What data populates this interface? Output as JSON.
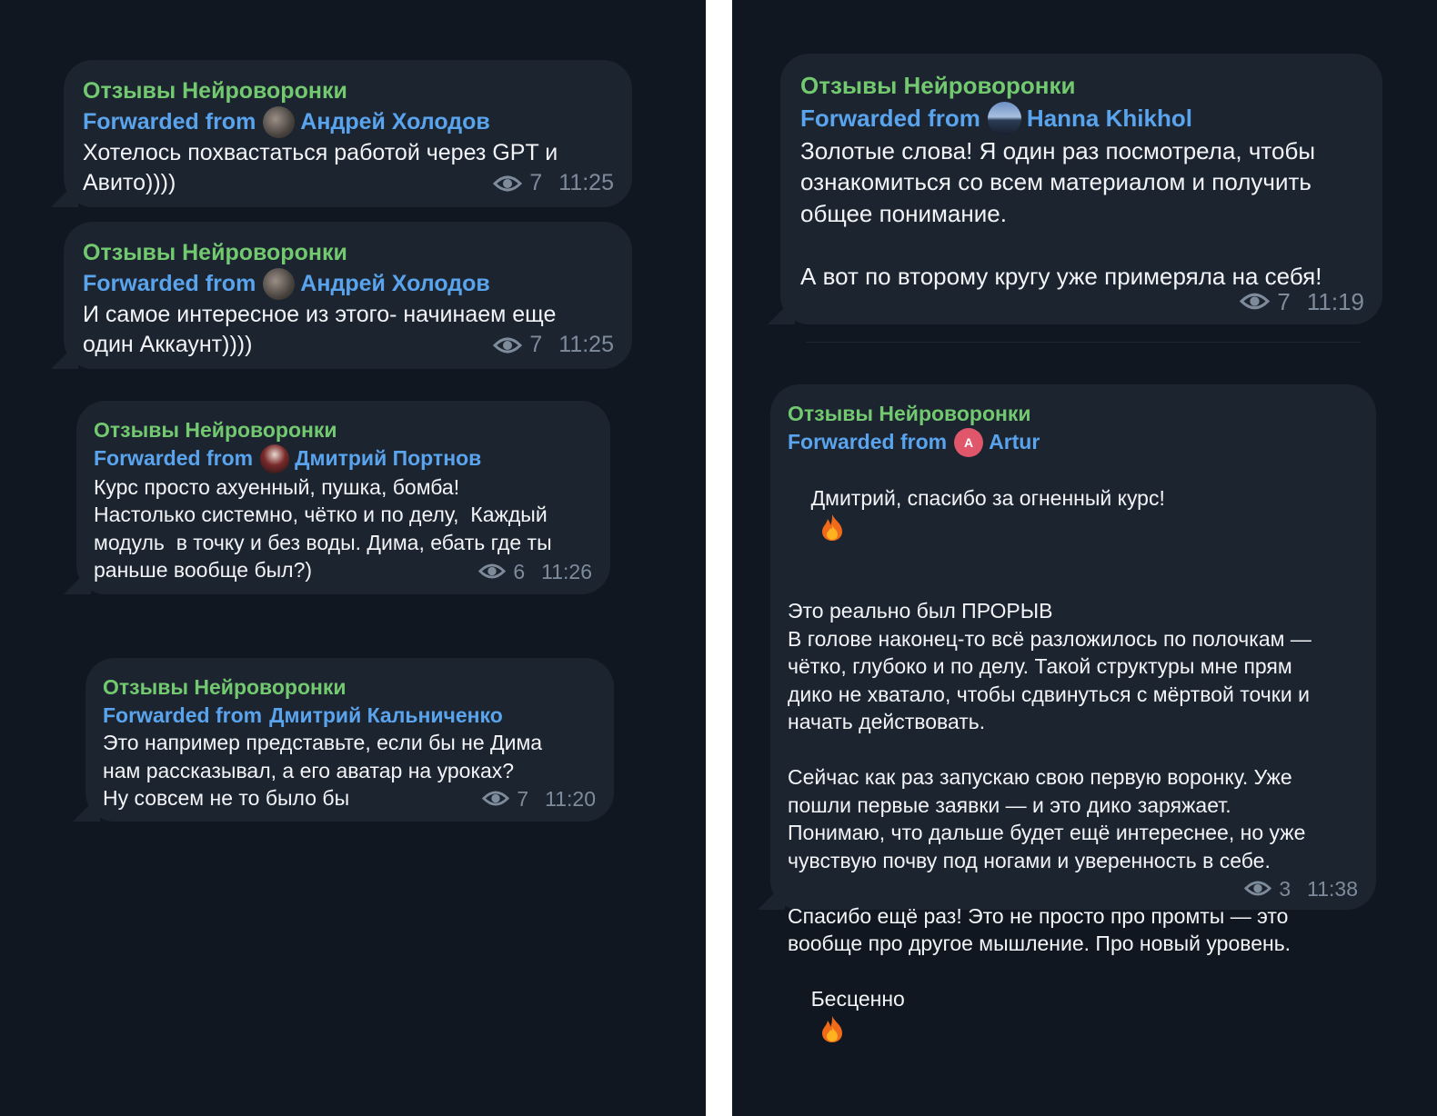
{
  "messages": [
    {
      "channel": "Отзывы Нейроворонки",
      "forward_prefix": "Forwarded from",
      "author": "Андрей Холодов",
      "text": "Хотелось похвастаться работой через GPT и\nАвито))))",
      "views": "7",
      "time": "11:25"
    },
    {
      "channel": "Отзывы Нейроворонки",
      "forward_prefix": "Forwarded from",
      "author": "Андрей Холодов",
      "text": "И самое интересное из этого- начинаем еще\nодин Аккаунт))))",
      "views": "7",
      "time": "11:25"
    },
    {
      "channel": "Отзывы Нейроворонки",
      "forward_prefix": "Forwarded from",
      "author": "Дмитрий Портнов",
      "text": "Курс просто ахуенный, пушка, бомба!\nНастолько системно, чётко и по делу,  Каждый\nмодуль  в точку и без воды. Дима, ебать где ты\nраньше вообще был?)",
      "views": "6",
      "time": "11:26"
    },
    {
      "channel": "Отзывы Нейроворонки",
      "forward_prefix": "Forwarded from",
      "author": "Дмитрий Кальниченко",
      "text": "Это например представьте, если бы не Дима\nнам рассказывал, а его аватар на уроках?\nНу совсем не то было бы",
      "views": "7",
      "time": "11:20"
    },
    {
      "channel": "Отзывы Нейроворонки",
      "forward_prefix": "Forwarded from",
      "author": "Hanna Khikhol",
      "text": "Золотые слова! Я один раз посмотрела, чтобы\nознакомиться со всем материалом и получить\nобщее понимание.\n\nА вот по второму кругу уже примеряла на себя!",
      "views": "7",
      "time": "11:19"
    },
    {
      "channel": "Отзывы Нейроворонки",
      "forward_prefix": "Forwarded from",
      "author": "Artur",
      "avatar_letter": "A",
      "text_first": "Дмитрий, спасибо за огненный курс!",
      "text": "\nЭто реально был ПРОРЫВ\nВ голове наконец-то всё разложилось по полочкам —\nчётко, глубоко и по делу. Такой структуры мне прям\nдико не хватало, чтобы сдвинуться с мёртвой точки и\nначать действовать.\n\nСейчас как раз запускаю свою первую воронку. Уже\nпошли первые заявки — и это дико заряжает.\nПонимаю, что дальше будет ещё интереснее, но уже\nчувствую почву под ногами и уверенность в себе.\n\nСпасибо ещё раз! Это не просто про промты — это\nвообще про другое мышление. Про новый уровень.",
      "text_last": "Бесценно",
      "views": "3",
      "time": "11:38"
    }
  ],
  "icons": {
    "views": "eye-icon",
    "emoji": "fire-emoji"
  },
  "colors": {
    "background": "#111720",
    "bubble": "#1c2430",
    "channel": "#72c96f",
    "forward": "#5aa4ee",
    "meta": "#7e8b9b",
    "avatar_artur": "#e0566a"
  }
}
